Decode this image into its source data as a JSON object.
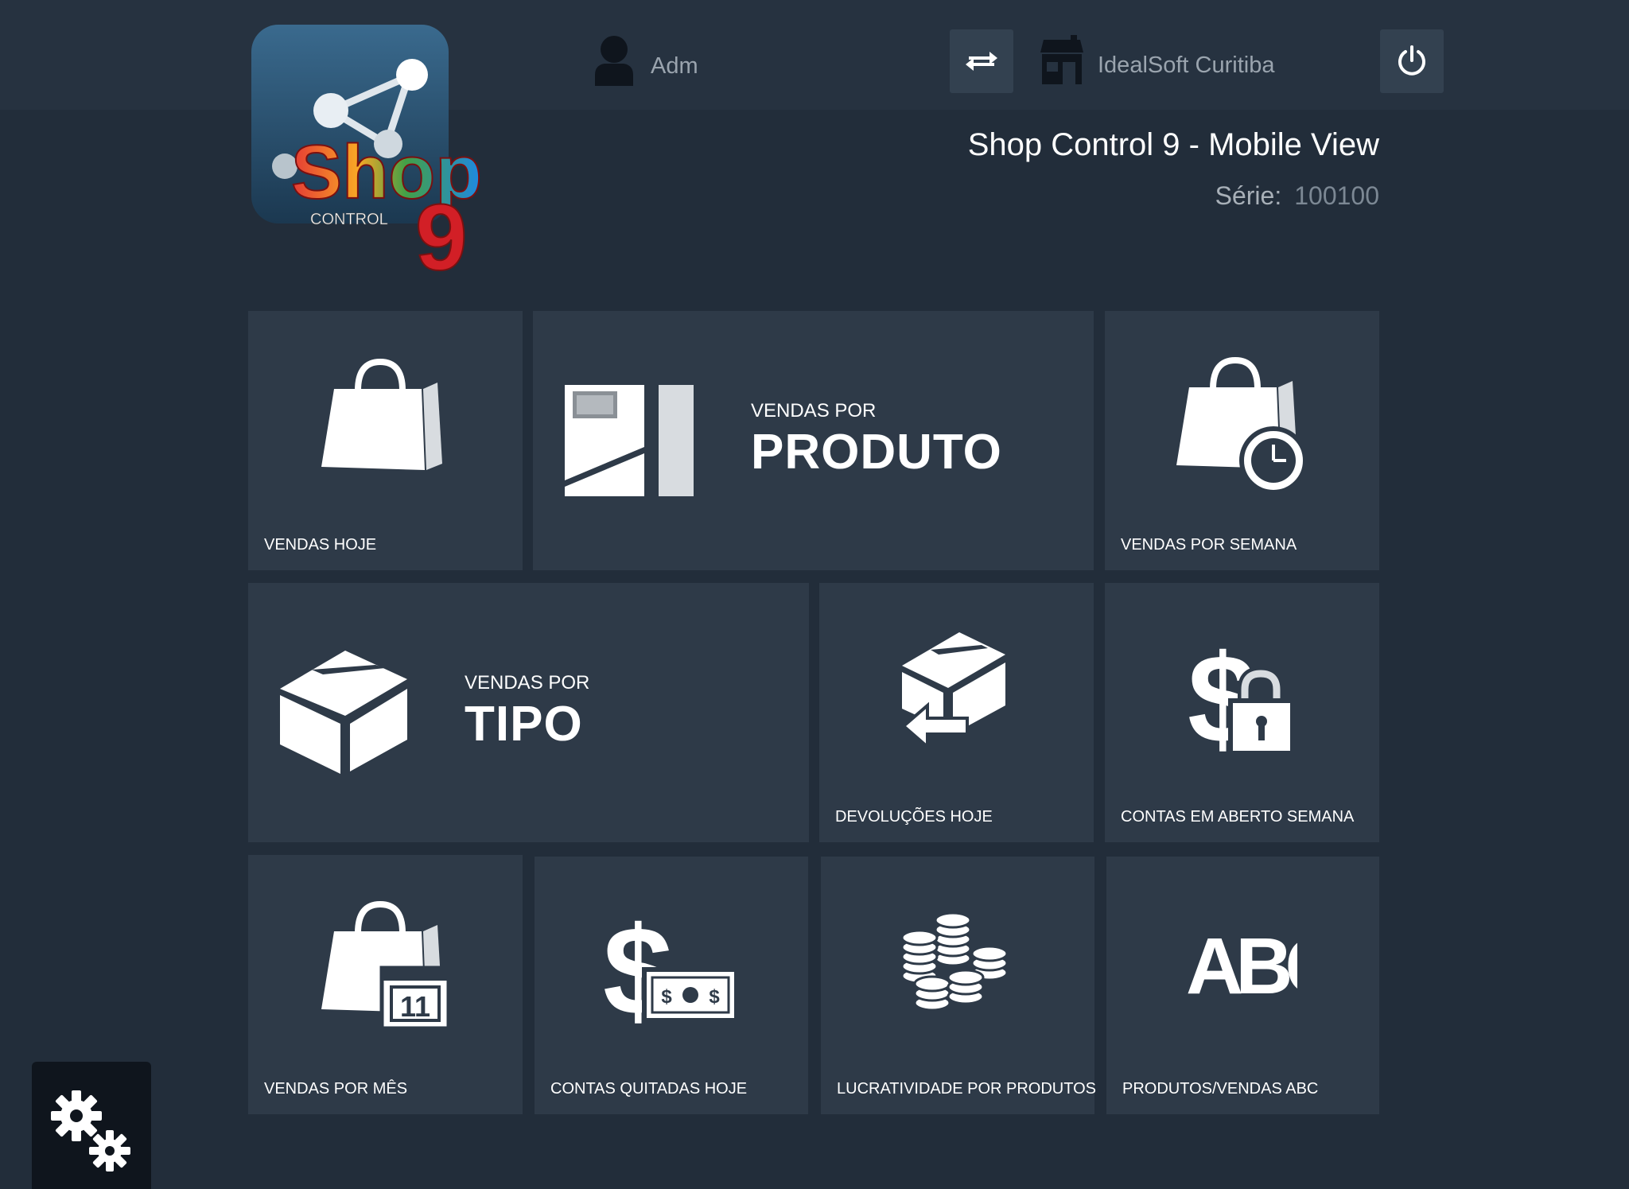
{
  "header": {
    "user_name": "Adm",
    "store_name": "IdealSoft Curitiba"
  },
  "app": {
    "title": "Shop Control 9 - Mobile View",
    "serie_label": "Série:",
    "serie_value": "100100"
  },
  "logo": {
    "text": "Shop",
    "subtext": "CONTROL",
    "number": "9"
  },
  "tiles": {
    "vendas_hoje": "VENDAS HOJE",
    "vendas_produto_small": "VENDAS POR",
    "vendas_produto_big": "PRODUTO",
    "vendas_semana": "VENDAS POR SEMANA",
    "vendas_tipo_small": "VENDAS POR",
    "vendas_tipo_big": "TIPO",
    "devolucoes_hoje": "DEVOLUÇÕES HOJE",
    "contas_aberto_semana": "CONTAS EM ABERTO SEMANA",
    "vendas_mes": "VENDAS POR MÊS",
    "calendar_day": "11",
    "contas_quitadas_hoje": "CONTAS QUITADAS HOJE",
    "lucratividade_produtos": "LUCRATIVIDADE POR PRODUTOS",
    "produtos_vendas_abc": "PRODUTOS/VENDAS ABC",
    "abc_icon_text": "ABC"
  },
  "colors": {
    "background": "#222d3a",
    "topbar": "#263240",
    "tile": "#2e3a48",
    "button": "#334150"
  },
  "icons": {
    "user": "user-icon",
    "swap": "swap-icon",
    "store": "store-icon",
    "power": "power-icon",
    "settings": "gears-icon"
  }
}
